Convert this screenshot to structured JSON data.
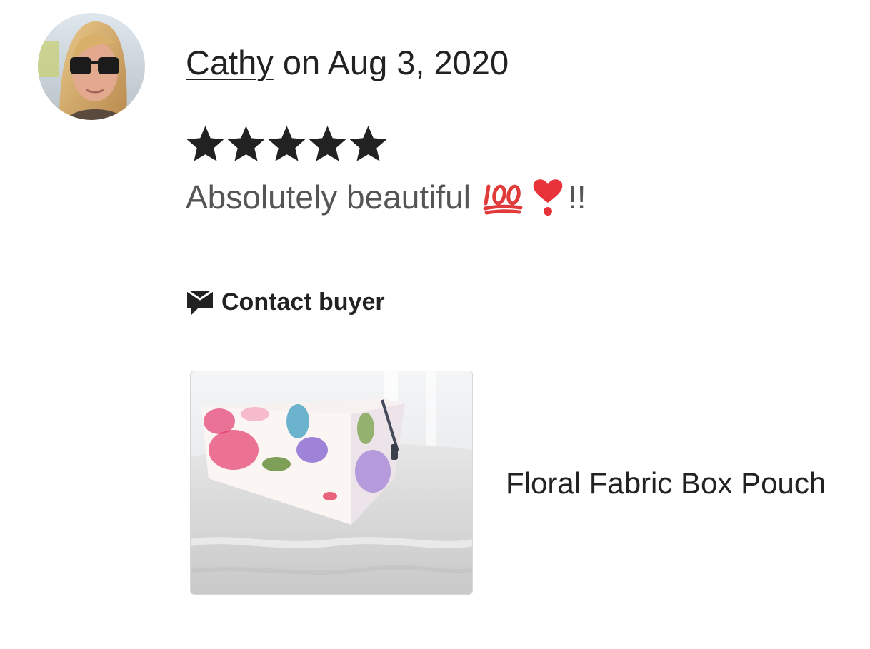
{
  "review": {
    "reviewer_name": "Cathy",
    "date_text": " on Aug 3, 2020",
    "rating": 5,
    "rating_max": 5,
    "text": "Absolutely beautiful",
    "text_suffix": "!!",
    "emojis": [
      "hundred-points-icon",
      "heart-exclamation-icon"
    ]
  },
  "actions": {
    "contact_label": "Contact buyer",
    "contact_icon": "message-icon"
  },
  "product": {
    "title": "Floral Fabric Box Pouch"
  },
  "colors": {
    "text": "#222222",
    "secondary_text": "#555555",
    "star": "#222222",
    "hundred_red": "#e03a3a",
    "heart_red": "#e8333b"
  }
}
